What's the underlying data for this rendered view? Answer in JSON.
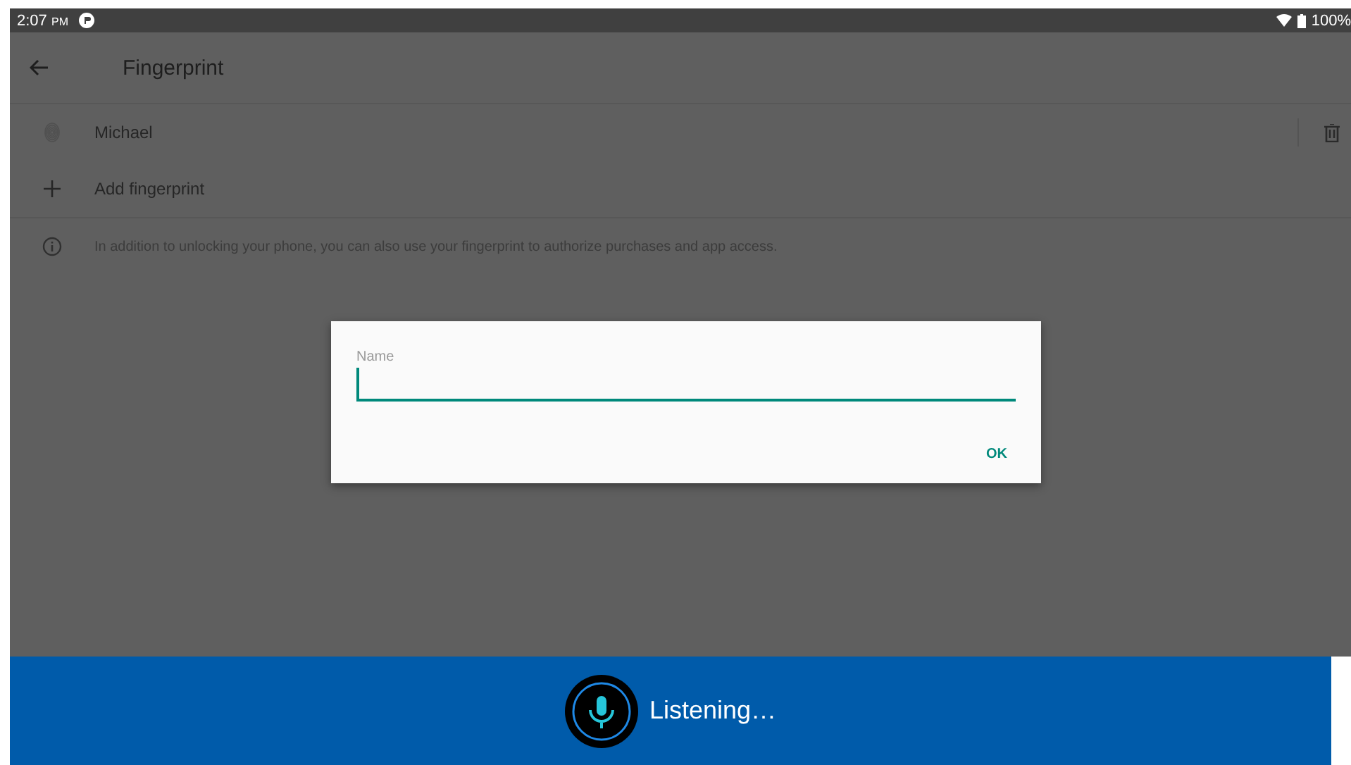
{
  "status_bar": {
    "time": "2:07",
    "ampm": "PM",
    "battery": "100%"
  },
  "app_bar": {
    "title": "Fingerprint"
  },
  "fingerprints": [
    {
      "name": "Michael"
    }
  ],
  "add_item": {
    "label": "Add fingerprint"
  },
  "info": {
    "text": "In addition to unlocking your phone, you can also use your fingerprint to authorize purchases and app access."
  },
  "dialog": {
    "field_label": "Name",
    "button": "OK"
  },
  "voice_bar": {
    "text": "Listening…"
  }
}
